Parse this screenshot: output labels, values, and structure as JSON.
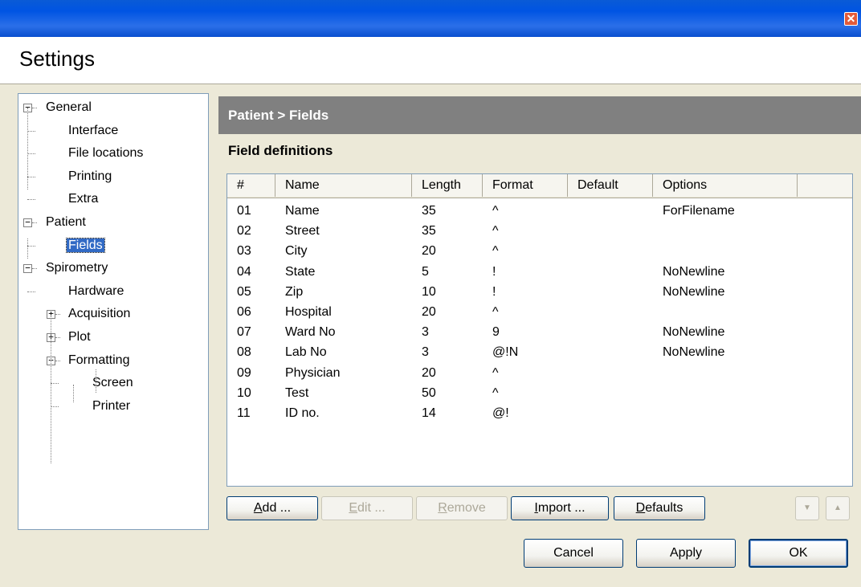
{
  "window": {
    "close_glyph": "✕"
  },
  "header": {
    "title": "Settings"
  },
  "tree": [
    {
      "label": "General",
      "expander": "−"
    },
    {
      "label": "Interface"
    },
    {
      "label": "File locations"
    },
    {
      "label": "Printing"
    },
    {
      "label": "Extra"
    },
    {
      "label": "Patient",
      "expander": "−"
    },
    {
      "label": "Fields",
      "selected": true
    },
    {
      "label": "Spirometry",
      "expander": "−"
    },
    {
      "label": "Hardware"
    },
    {
      "label": "Acquisition",
      "expander": "+"
    },
    {
      "label": "Plot",
      "expander": "+"
    },
    {
      "label": "Formatting",
      "expander": "−"
    },
    {
      "label": "Screen"
    },
    {
      "label": "Printer"
    }
  ],
  "content": {
    "section_title": "Patient > Fields",
    "subtitle": "Field definitions"
  },
  "table": {
    "columns": [
      "#",
      "Name",
      "Length",
      "Format",
      "Default",
      "Options"
    ],
    "rows": [
      [
        "01",
        "Name",
        "35",
        "^",
        "",
        "ForFilename"
      ],
      [
        "02",
        "Street",
        "35",
        "^",
        "",
        ""
      ],
      [
        "03",
        "City",
        "20",
        "^",
        "",
        ""
      ],
      [
        "04",
        "State",
        "5",
        "!",
        "",
        "NoNewline"
      ],
      [
        "05",
        "Zip",
        "10",
        "!",
        "",
        "NoNewline"
      ],
      [
        "06",
        "Hospital",
        "20",
        "^",
        "",
        ""
      ],
      [
        "07",
        "Ward No",
        "3",
        "9",
        "",
        "NoNewline"
      ],
      [
        "08",
        "Lab No",
        "3",
        "@!N",
        "",
        "NoNewline"
      ],
      [
        "09",
        "Physician",
        "20",
        "^",
        "",
        ""
      ],
      [
        "10",
        "Test",
        "50",
        "^",
        "",
        ""
      ],
      [
        "11",
        "ID no.",
        "14",
        "@!",
        "",
        ""
      ]
    ]
  },
  "buttons": {
    "add": {
      "mnemonic": "A",
      "rest": "dd ..."
    },
    "edit": {
      "mnemonic": "E",
      "rest": "dit ..."
    },
    "remove": {
      "mnemonic": "R",
      "rest": "emove"
    },
    "import": {
      "mnemonic": "I",
      "rest": "mport ..."
    },
    "defaults": {
      "mnemonic": "D",
      "rest": "efaults"
    },
    "down_glyph": "▼",
    "up_glyph": "▲",
    "cancel": "Cancel",
    "apply": "Apply",
    "ok": "OK"
  }
}
